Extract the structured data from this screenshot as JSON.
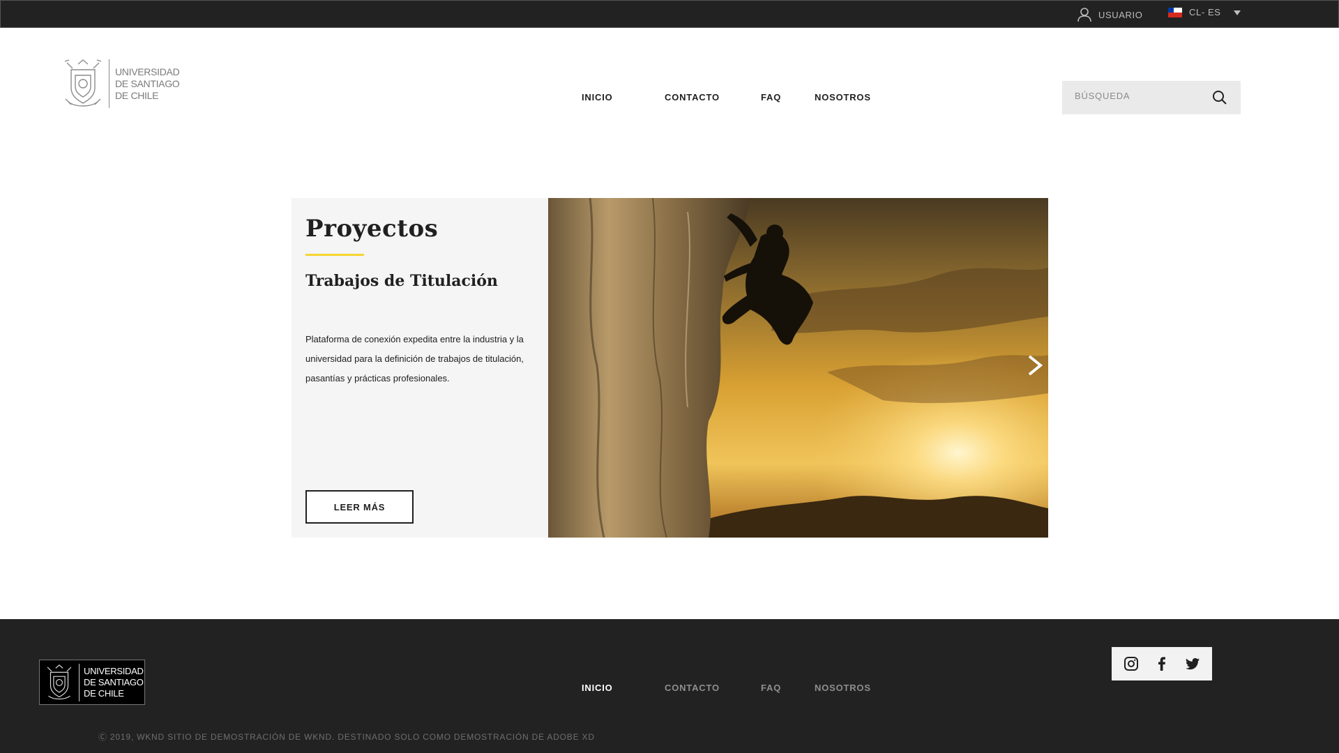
{
  "topbar": {
    "user_label": "USUARIO",
    "lang_label": "CL- ES"
  },
  "header": {
    "logo_lines": [
      "UNIVERSIDAD",
      "DE SANTIAGO",
      "DE CHILE"
    ],
    "nav": [
      "INICIO",
      "CONTACTO",
      "FAQ",
      "NOSOTROS"
    ],
    "search_placeholder": "BÚSQUEDA"
  },
  "card": {
    "title": "Proyectos",
    "subtitle": "Trabajos de Titulación",
    "description": "Plataforma de conexión expedita entre la industria y la universidad para la definición de trabajos de titulación, pasantías y prácticas profesionales.",
    "button_label": "LEER MÁS",
    "accent_color": "#f6d531"
  },
  "footer": {
    "logo_lines": [
      "UNIVERSIDAD",
      "DE SANTIAGO",
      "DE CHILE"
    ],
    "nav": [
      "INICIO",
      "CONTACTO",
      "FAQ",
      "NOSOTROS"
    ],
    "active_nav": "INICIO",
    "social": [
      "instagram-icon",
      "facebook-icon",
      "twitter-icon"
    ],
    "copyright": "Ⓒ 2019, WKND SITIO DE DEMOSTRACIÓN DE WKND. DESTINADO SOLO COMO DEMOSTRACIÓN DE ADOBE XD"
  }
}
